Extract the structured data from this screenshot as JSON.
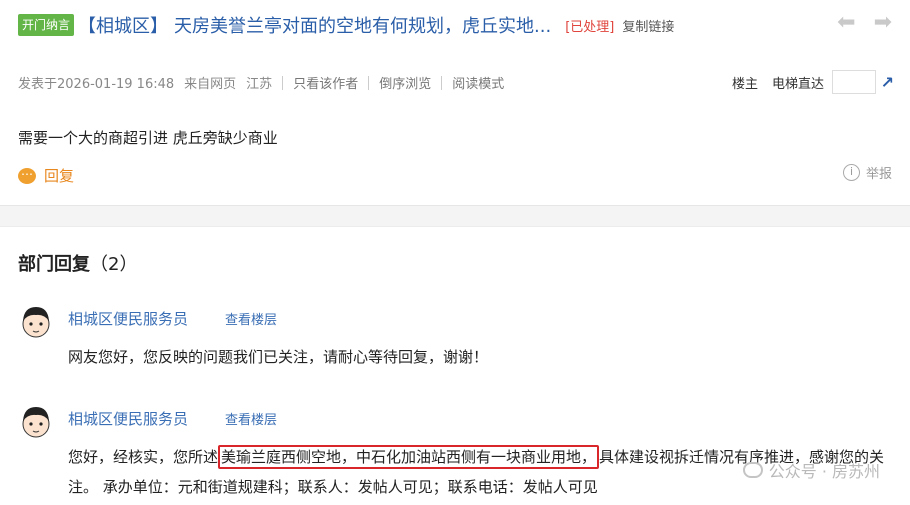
{
  "post": {
    "tag": "开门纳言",
    "district": "【相城区】",
    "title": "天房美誉兰亭对面的空地有何规划，虎丘实地...",
    "status": "[已处理]",
    "copy_link": "复制链接",
    "meta": {
      "posted": "发表于2026-01-19 16:48",
      "source": "来自网页",
      "location": "江苏",
      "only_author": "只看该作者",
      "reverse_order": "倒序浏览",
      "read_mode": "阅读模式",
      "louzhu": "楼主",
      "elevator": "电梯直达"
    },
    "content": "需要一个大的商超引进 虎丘旁缺少商业",
    "reply_label": "回复",
    "report_label": "举报"
  },
  "dept": {
    "title": "部门回复",
    "count": "（2）",
    "replies": [
      {
        "author": "相城区便民服务员",
        "view_floor": "查看楼层",
        "text": "网友您好，您反映的问题我们已关注，请耐心等待回复，谢谢！"
      },
      {
        "author": "相城区便民服务员",
        "view_floor": "查看楼层",
        "text_before": "您好，经核实，您所述",
        "text_highlight": "美瑜兰庭西侧空地，中石化加油站西侧有一块商业用地，",
        "text_after": "具体建设视拆迁情况有序推进，感谢您的关注。 承办单位：元和街道规建科；联系人：发帖人可见；联系电话：发帖人可见"
      }
    ]
  },
  "watermark": "公众号 · 房苏州",
  "colors": {
    "tag_green": "#63b547",
    "link_blue": "#2a5ea8",
    "status_red": "#e0443c",
    "reply_orange": "#e8871e",
    "highlight_red": "#d8262a"
  }
}
